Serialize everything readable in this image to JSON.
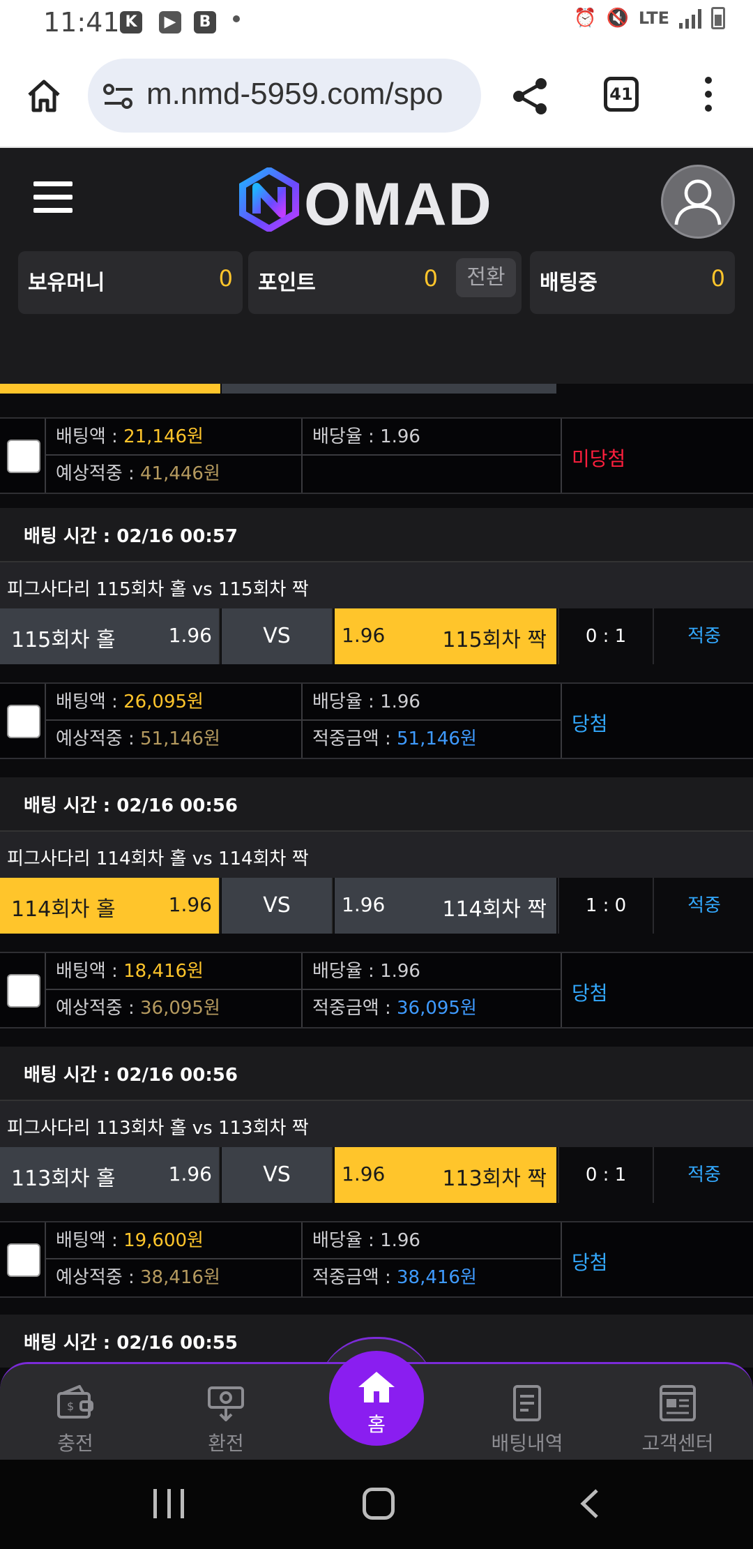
{
  "status_bar": {
    "time": "11:41",
    "icons": [
      "alarm-icon",
      "mute-icon",
      "lte-icon",
      "signal-icon",
      "battery-icon"
    ],
    "network": "LTE"
  },
  "browser": {
    "url": "m.nmd-5959.com/spo",
    "tab_count": "41"
  },
  "header": {
    "logo": "NOMAD",
    "balances": [
      {
        "label": "보유머니",
        "value": "0"
      },
      {
        "label": "포인트",
        "value": "0"
      },
      {
        "label": "배팅중",
        "value": "0"
      }
    ],
    "convert_label": "전환"
  },
  "bets": {
    "first_result": {
      "bet_amount_label": "배팅액 : ",
      "bet_amount": "21,146원",
      "expected_label": "예상적중 : ",
      "expected": "41,446원",
      "odds_label": "배당율 : ",
      "odds": "1.96",
      "status": "미당첨"
    },
    "items": [
      {
        "time_label": "배팅 시간 : 02/16 00:57",
        "title": "피그사다리 115회차 홀  vs  115회차 짝",
        "home_name": "115회차 홀",
        "home_odds": "1.96",
        "vs": "VS",
        "away_odds": "1.96",
        "away_name": "115회차 짝",
        "selected": "away",
        "score": "0 : 1",
        "result": "적중",
        "bet_amount_label": "배팅액 : ",
        "bet_amount": "26,095원",
        "expected_label": "예상적중 : ",
        "expected": "51,146원",
        "odds_label": "배당율 : ",
        "odds": "1.96",
        "win_label": "적중금액 : ",
        "win_amount": "51,146원",
        "status": "당첨"
      },
      {
        "time_label": "배팅 시간 : 02/16 00:56",
        "title": "피그사다리 114회차 홀  vs  114회차 짝",
        "home_name": "114회차 홀",
        "home_odds": "1.96",
        "vs": "VS",
        "away_odds": "1.96",
        "away_name": "114회차 짝",
        "selected": "home",
        "score": "1 : 0",
        "result": "적중",
        "bet_amount_label": "배팅액 : ",
        "bet_amount": "18,416원",
        "expected_label": "예상적중 : ",
        "expected": "36,095원",
        "odds_label": "배당율 : ",
        "odds": "1.96",
        "win_label": "적중금액 : ",
        "win_amount": "36,095원",
        "status": "당첨"
      },
      {
        "time_label": "배팅 시간 : 02/16 00:56",
        "title": "피그사다리 113회차 홀  vs  113회차 짝",
        "home_name": "113회차 홀",
        "home_odds": "1.96",
        "vs": "VS",
        "away_odds": "1.96",
        "away_name": "113회차 짝",
        "selected": "away",
        "score": "0 : 1",
        "result": "적중",
        "bet_amount_label": "배팅액 : ",
        "bet_amount": "19,600원",
        "expected_label": "예상적중 : ",
        "expected": "38,416원",
        "odds_label": "배당율 : ",
        "odds": "1.96",
        "win_label": "적중금액 : ",
        "win_amount": "38,416원",
        "status": "당첨"
      }
    ],
    "last_time_label": "배팅 시간 : 02/16 00:55"
  },
  "bottom_nav": {
    "items": [
      {
        "label": "충전",
        "icon": "wallet-icon"
      },
      {
        "label": "환전",
        "icon": "withdraw-icon"
      },
      {
        "label": "홈",
        "icon": "home-icon"
      },
      {
        "label": "배팅내역",
        "icon": "document-icon"
      },
      {
        "label": "고객센터",
        "icon": "newspaper-icon"
      }
    ]
  },
  "colors": {
    "accent_yellow": "#ffc52b",
    "accent_purple": "#8a1ef0",
    "win_blue": "#33a9ff",
    "lose_red": "#ff1f3d"
  }
}
